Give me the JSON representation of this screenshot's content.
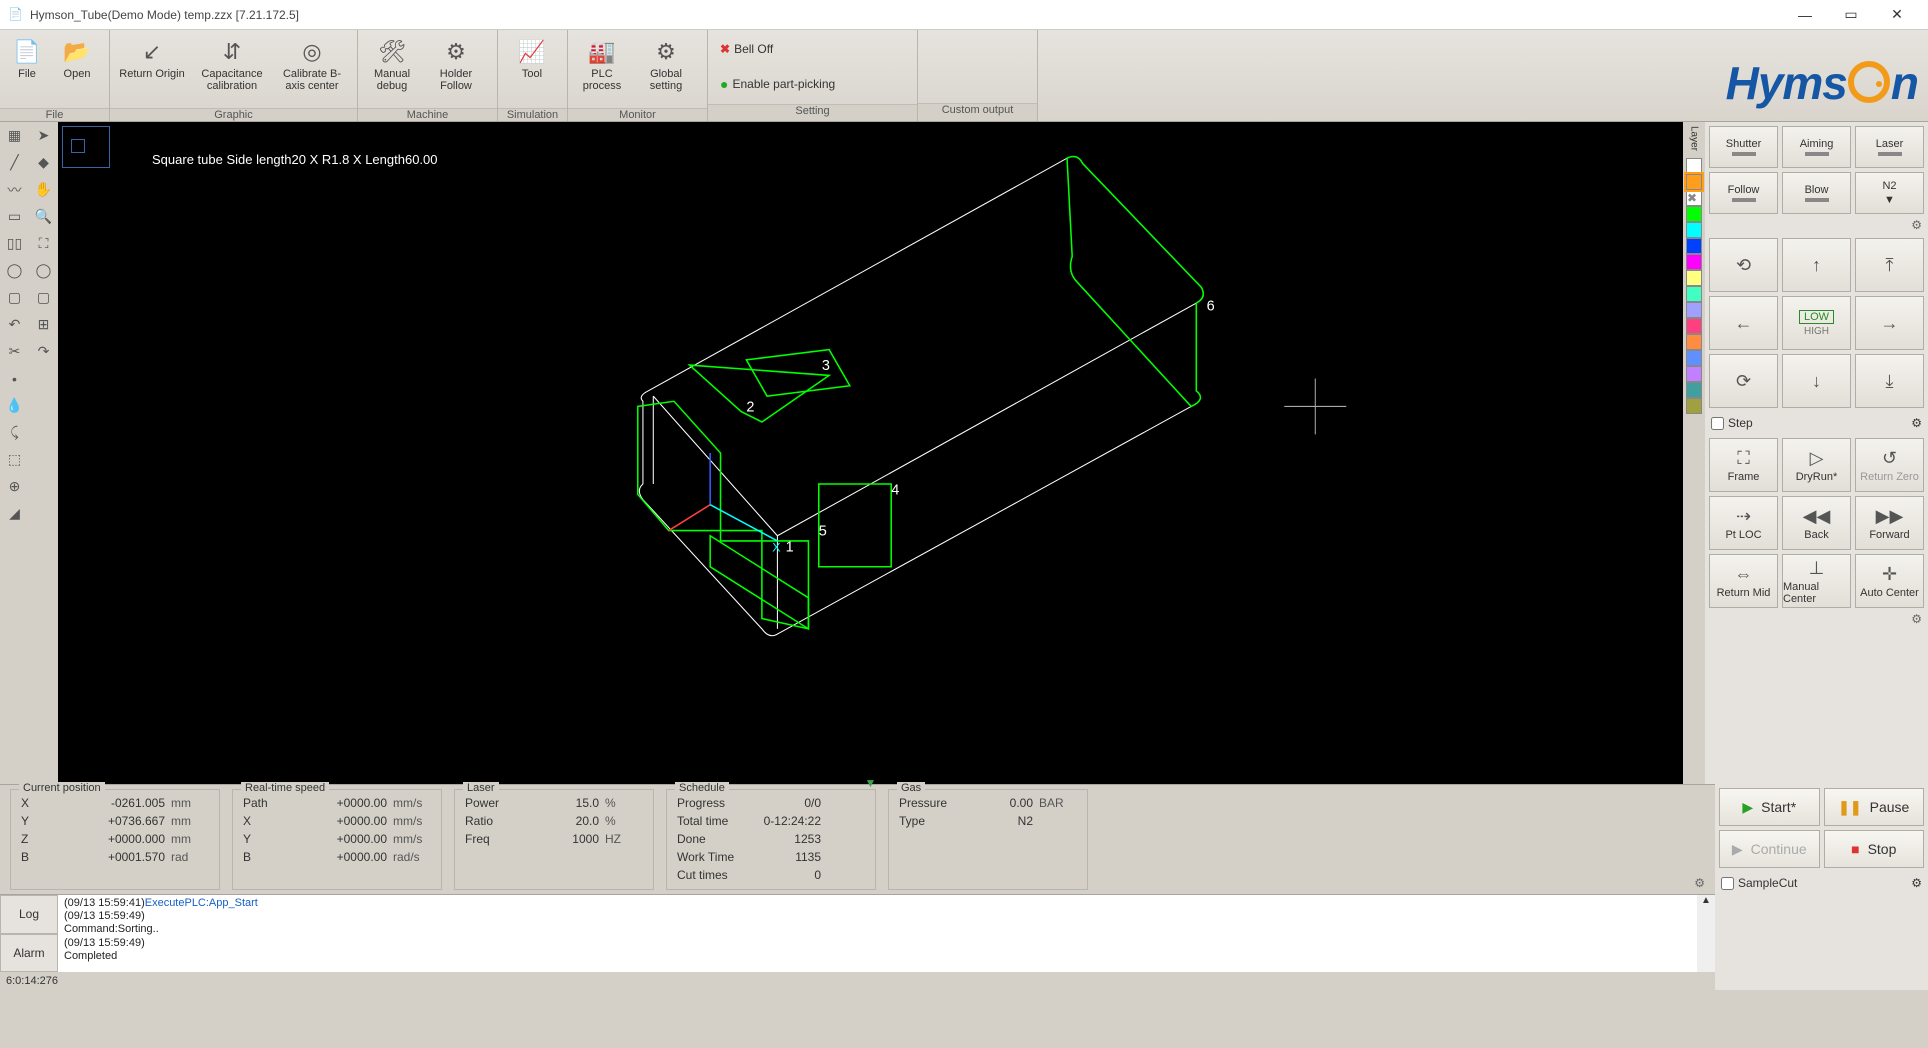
{
  "window": {
    "title": "Hymson_Tube(Demo Mode) temp.zzx  [7.21.172.5]"
  },
  "ribbon": {
    "file": {
      "file": "File",
      "open": "Open",
      "group": "File"
    },
    "graphic": {
      "returnOrigin": "Return Origin",
      "capCal": "Capacitance calibration",
      "calB": "Calibrate B-axis center",
      "group": "Graphic"
    },
    "machine": {
      "manualDebug": "Manual debug",
      "holderFollow": "Holder Follow",
      "group": "Machine"
    },
    "simulation": {
      "tool": "Tool",
      "group": "Simulation"
    },
    "monitor": {
      "plc": "PLC process",
      "global": "Global setting",
      "group": "Monitor"
    },
    "setting": {
      "bellOff": "Bell Off",
      "partPick": "Enable part-picking",
      "group": "Setting"
    },
    "custom": {
      "group": "Custom output"
    }
  },
  "canvas": {
    "desc": "Square tube Side length20 X R1.8 X Length60.00",
    "labels": [
      "1",
      "2",
      "3",
      "4",
      "5",
      "6"
    ]
  },
  "layers": {
    "header": "Layer",
    "colors": [
      "#ffffff",
      "#ff9e1a",
      "#ffffff",
      "#00ff00",
      "#00ffff",
      "#0040ff",
      "#ff00ff",
      "#ffff80",
      "#40ffc0",
      "#a0a0ff",
      "#ff4080",
      "#ff8c40",
      "#6090ff",
      "#c080ff",
      "#40a0a0",
      "#a0a040"
    ]
  },
  "controls": {
    "shutter": "Shutter",
    "aiming": "Aiming",
    "laser": "Laser",
    "follow": "Follow",
    "blow": "Blow",
    "gasSel": "N2",
    "lowHigh_low": "LOW",
    "lowHigh_high": "HIGH",
    "step": "Step",
    "frame": "Frame",
    "dryRun": "DryRun*",
    "returnZero": "Return Zero",
    "ptLoc": "Pt LOC",
    "back": "Back",
    "forward": "Forward",
    "returnMid": "Return Mid",
    "manualCenter": "Manual Center",
    "autoCenter": "Auto Center"
  },
  "actions": {
    "start": "Start*",
    "pause": "Pause",
    "cont": "Continue",
    "stop": "Stop",
    "sampleCut": "SampleCut"
  },
  "status": {
    "pos": {
      "hdr": "Current position",
      "rows": [
        {
          "k": "X",
          "v": "-0261.005",
          "u": "mm"
        },
        {
          "k": "Y",
          "v": "+0736.667",
          "u": "mm"
        },
        {
          "k": "Z",
          "v": "+0000.000",
          "u": "mm"
        },
        {
          "k": "B",
          "v": "+0001.570",
          "u": "rad"
        }
      ]
    },
    "speed": {
      "hdr": "Real-time speed",
      "rows": [
        {
          "k": "Path",
          "v": "+0000.00",
          "u": "mm/s"
        },
        {
          "k": "X",
          "v": "+0000.00",
          "u": "mm/s"
        },
        {
          "k": "Y",
          "v": "+0000.00",
          "u": "mm/s"
        },
        {
          "k": "B",
          "v": "+0000.00",
          "u": "rad/s"
        }
      ]
    },
    "laser": {
      "hdr": "Laser",
      "rows": [
        {
          "k": "Power",
          "v": "15.0",
          "u": "%"
        },
        {
          "k": "Ratio",
          "v": "20.0",
          "u": "%"
        },
        {
          "k": "Freq",
          "v": "1000",
          "u": "HZ"
        }
      ]
    },
    "sched": {
      "hdr": "Schedule",
      "rows": [
        {
          "k": "Progress",
          "v": "0/0",
          "u": ""
        },
        {
          "k": "Total time",
          "v": "0-12:24:22",
          "u": ""
        },
        {
          "k": "Done",
          "v": "1253",
          "u": ""
        },
        {
          "k": "Work Time",
          "v": "1135",
          "u": ""
        },
        {
          "k": "Cut times",
          "v": "0",
          "u": ""
        }
      ]
    },
    "gas": {
      "hdr": "Gas",
      "rows": [
        {
          "k": "Pressure",
          "v": "0.00",
          "u": "BAR"
        },
        {
          "k": "Type",
          "v": "N2",
          "u": ""
        }
      ]
    }
  },
  "log": {
    "tabs": {
      "log": "Log",
      "alarm": "Alarm"
    },
    "lines": [
      {
        "ts": "(09/13 15:59:41)",
        "msg": "ExecutePLC:App_Start",
        "cls": "link"
      },
      {
        "ts": "(09/13 15:59:49)",
        "msg": "",
        "cls": ""
      },
      {
        "ts": "",
        "msg": "Command:Sorting..",
        "cls": ""
      },
      {
        "ts": "(09/13 15:59:49)",
        "msg": "",
        "cls": ""
      },
      {
        "ts": "",
        "msg": "Completed",
        "cls": ""
      }
    ]
  },
  "footer": "6:0:14:276"
}
